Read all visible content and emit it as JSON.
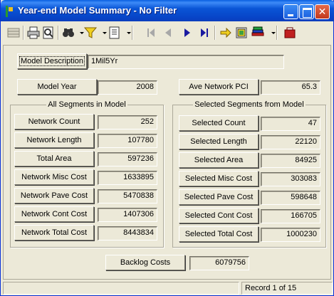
{
  "window": {
    "title": "Year-end Model Summary - No Filter"
  },
  "toolbar": {
    "icons": [
      "grid-icon",
      "print-icon",
      "print-preview-icon",
      "binoculars-icon",
      "filter-icon",
      "report-icon",
      "first-record-icon",
      "previous-record-icon",
      "next-record-icon",
      "last-record-icon",
      "goto-icon",
      "export-icon",
      "books-icon",
      "exit-icon"
    ]
  },
  "model": {
    "description_label": "Model Description",
    "description_value": "1Mil5Yr",
    "year_label": "Model Year",
    "year_value": "2008",
    "pci_label": "Ave Network PCI",
    "pci_value": "65.3"
  },
  "all_segments": {
    "title": "All Segments in Model",
    "rows": [
      {
        "label": "Network Count",
        "value": "252"
      },
      {
        "label": "Network Length",
        "value": "107780"
      },
      {
        "label": "Total Area",
        "value": "597236"
      },
      {
        "label": "Network Misc Cost",
        "value": "1633895"
      },
      {
        "label": "Network Pave Cost",
        "value": "5470838"
      },
      {
        "label": "Network Cont Cost",
        "value": "1407306"
      },
      {
        "label": "Network Total Cost",
        "value": "8443834"
      }
    ]
  },
  "selected_segments": {
    "title": "Selected Segments from Model",
    "rows": [
      {
        "label": "Selected Count",
        "value": "47"
      },
      {
        "label": "Selected Length",
        "value": "22120"
      },
      {
        "label": "Selected Area",
        "value": "84925"
      },
      {
        "label": "Selected Misc Cost",
        "value": "303083"
      },
      {
        "label": "Selected Pave Cost",
        "value": "598648"
      },
      {
        "label": "Selected Cont Cost",
        "value": "166705"
      },
      {
        "label": "Selected Total Cost",
        "value": "1000230"
      }
    ]
  },
  "backlog": {
    "label": "Backlog Costs",
    "value": "6079756"
  },
  "status": {
    "record": "Record 1 of 15"
  }
}
